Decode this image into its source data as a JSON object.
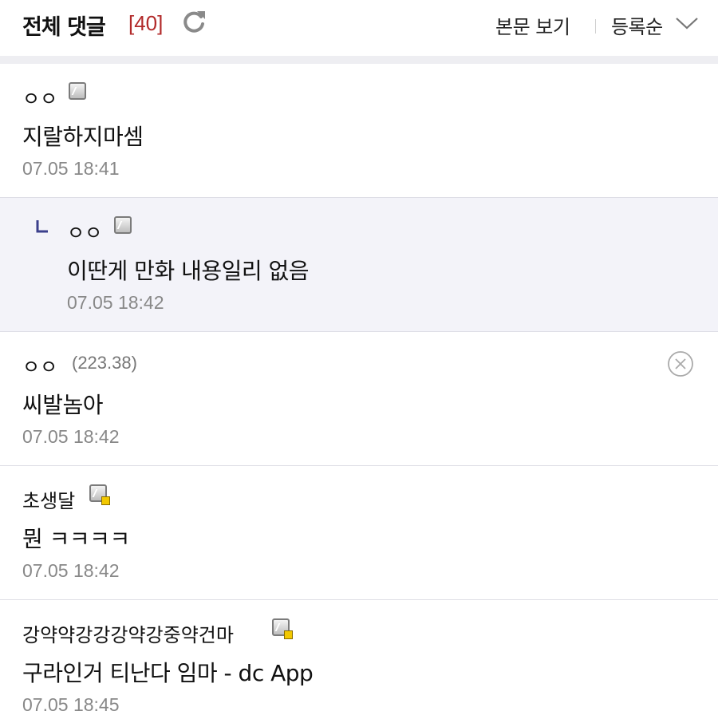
{
  "header": {
    "title": "전체 댓글",
    "count": "[40]",
    "view_body_label": "본문 보기",
    "sort_label": "등록순",
    "refresh_icon": "refresh-icon",
    "sort_icon": "chevron-down-icon"
  },
  "colors": {
    "count": "#b22a2a",
    "reply_bg": "#f3f3f9",
    "divider": "#eeeef2",
    "gold_badge": "#f2c800"
  },
  "comments": [
    {
      "nick": "ㅇㅇ",
      "badge": "gallog-icon",
      "text": "지랄하지마셈",
      "date": "07.05 18:41"
    },
    {
      "nick": "ㅇㅇ",
      "badge": "gallog-icon",
      "text": "이딴게 만화 내용일리 없음",
      "date": "07.05 18:42",
      "is_reply": true
    },
    {
      "nick": "ㅇㅇ",
      "ip": "(223.38)",
      "text": "씨발놈아",
      "date": "07.05 18:42",
      "delete_icon": "close-circle-icon"
    },
    {
      "nick": "초생달",
      "badge": "gallog-fixed-icon",
      "text": "뭔 ㅋㅋㅋㅋ",
      "date": "07.05 18:42"
    },
    {
      "nick": "강약약강강강약강중약건마",
      "badge": "gallog-fixed-icon",
      "text": "구라인거 티난다 임마 - dc App",
      "date": "07.05 18:45"
    }
  ]
}
